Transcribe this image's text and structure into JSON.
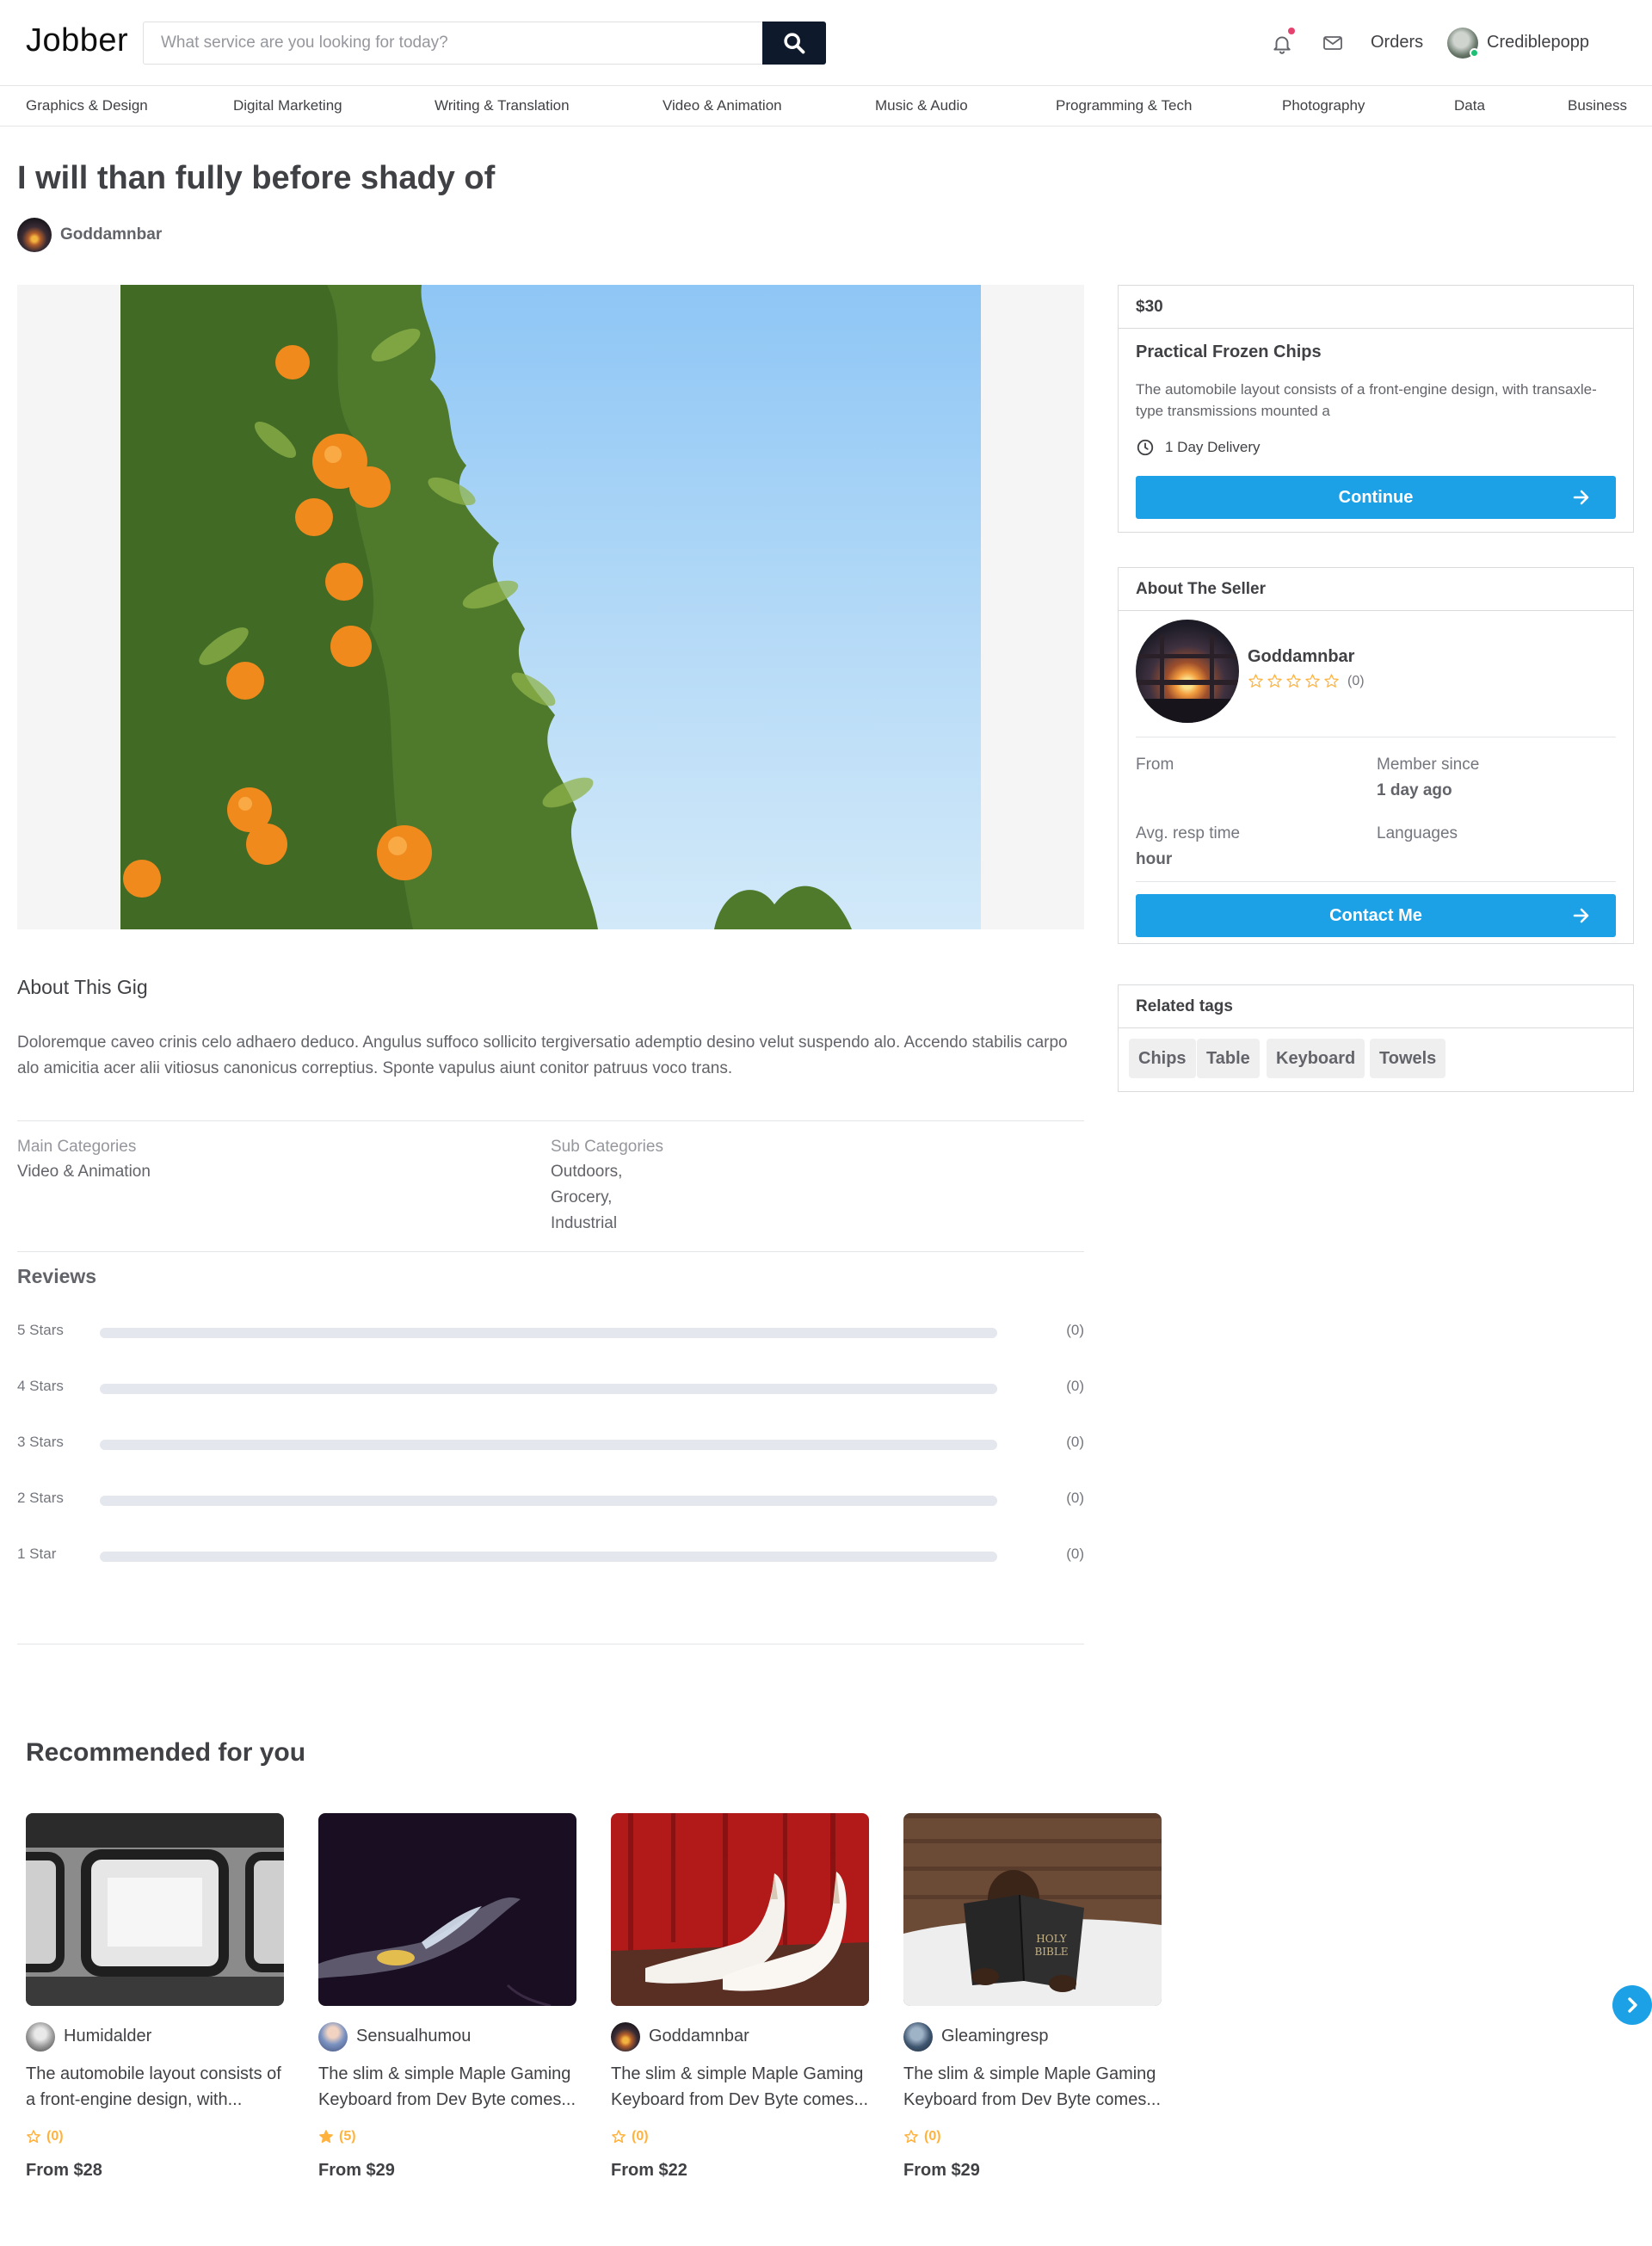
{
  "header": {
    "logo": "Jobber",
    "search_placeholder": "What service are you looking for today?",
    "orders_label": "Orders",
    "username": "Crediblepopp",
    "icons": [
      "search-icon",
      "bell-icon",
      "mail-icon"
    ],
    "notification_dot_color": "#e6426e"
  },
  "categories": [
    "Graphics & Design",
    "Digital Marketing",
    "Writing & Translation",
    "Video & Animation",
    "Music & Audio",
    "Programming & Tech",
    "Photography",
    "Data",
    "Business"
  ],
  "gig": {
    "title": "I will than fully before shady of",
    "seller": "Goddamnbar"
  },
  "about": {
    "title": "About This Gig",
    "text": "Doloremque caveo crinis celo adhaero deduco. Angulus suffoco sollicito tergiversatio ademptio desino velut suspendo alo. Accendo stabilis carpo alo amicitia acer alii vitiosus canonicus correptius. Sponte vapulus aiunt conitor patruus voco trans.",
    "main_categories_label": "Main Categories",
    "main_category": "Video & Animation",
    "sub_categories_label": "Sub Categories",
    "sub_categories": [
      "Outdoors,",
      "Grocery,",
      "Industrial"
    ]
  },
  "reviews": {
    "title": "Reviews",
    "rows": [
      {
        "label": "5 Stars",
        "count": "(0)",
        "fraction": 0
      },
      {
        "label": "4 Stars",
        "count": "(0)",
        "fraction": 0
      },
      {
        "label": "3 Stars",
        "count": "(0)",
        "fraction": 0
      },
      {
        "label": "2 Stars",
        "count": "(0)",
        "fraction": 0
      },
      {
        "label": "1 Star",
        "count": "(0)",
        "fraction": 0
      }
    ]
  },
  "package": {
    "price": "$30",
    "name": "Practical Frozen Chips",
    "description": "The automobile layout consists of a front-engine design, with transaxle-type transmissions mounted a",
    "delivery": "1 Day Delivery",
    "button": "Continue",
    "accent_color": "#1da1e6"
  },
  "seller_card": {
    "title": "About The Seller",
    "name": "Goddamnbar",
    "rating_count": "(0)",
    "rating_stars": 0,
    "from_label": "From",
    "from_value": "",
    "member_since_label": "Member since",
    "member_since_value": "1 day ago",
    "resp_label": "Avg. resp time",
    "resp_value": "hour",
    "languages_label": "Languages",
    "languages_value": "",
    "button": "Contact Me"
  },
  "tags": {
    "title": "Related tags",
    "items": [
      "Chips",
      "Table",
      "Keyboard",
      "Towels"
    ]
  },
  "recommended": {
    "title": "Recommended for you",
    "items": [
      {
        "seller": "Humidalder",
        "desc_line1": "The automobile layout consists of",
        "desc_line2": "a front-engine design, with...",
        "rating": "(0)",
        "filled": false,
        "price": "From $28"
      },
      {
        "seller": "Sensualhumou",
        "desc_line1": "The slim & simple Maple Gaming",
        "desc_line2": "Keyboard from Dev Byte comes...",
        "rating": "(5)",
        "filled": true,
        "price": "From $29"
      },
      {
        "seller": "Goddamnbar",
        "desc_line1": "The slim & simple Maple Gaming",
        "desc_line2": "Keyboard from Dev Byte comes...",
        "rating": "(0)",
        "filled": false,
        "price": "From $22"
      },
      {
        "seller": "Gleamingresp",
        "desc_line1": "The slim & simple Maple Gaming",
        "desc_line2": "Keyboard from Dev Byte comes...",
        "rating": "(0)",
        "filled": false,
        "price": "From $29"
      }
    ],
    "star_color": "#ffb33e"
  }
}
